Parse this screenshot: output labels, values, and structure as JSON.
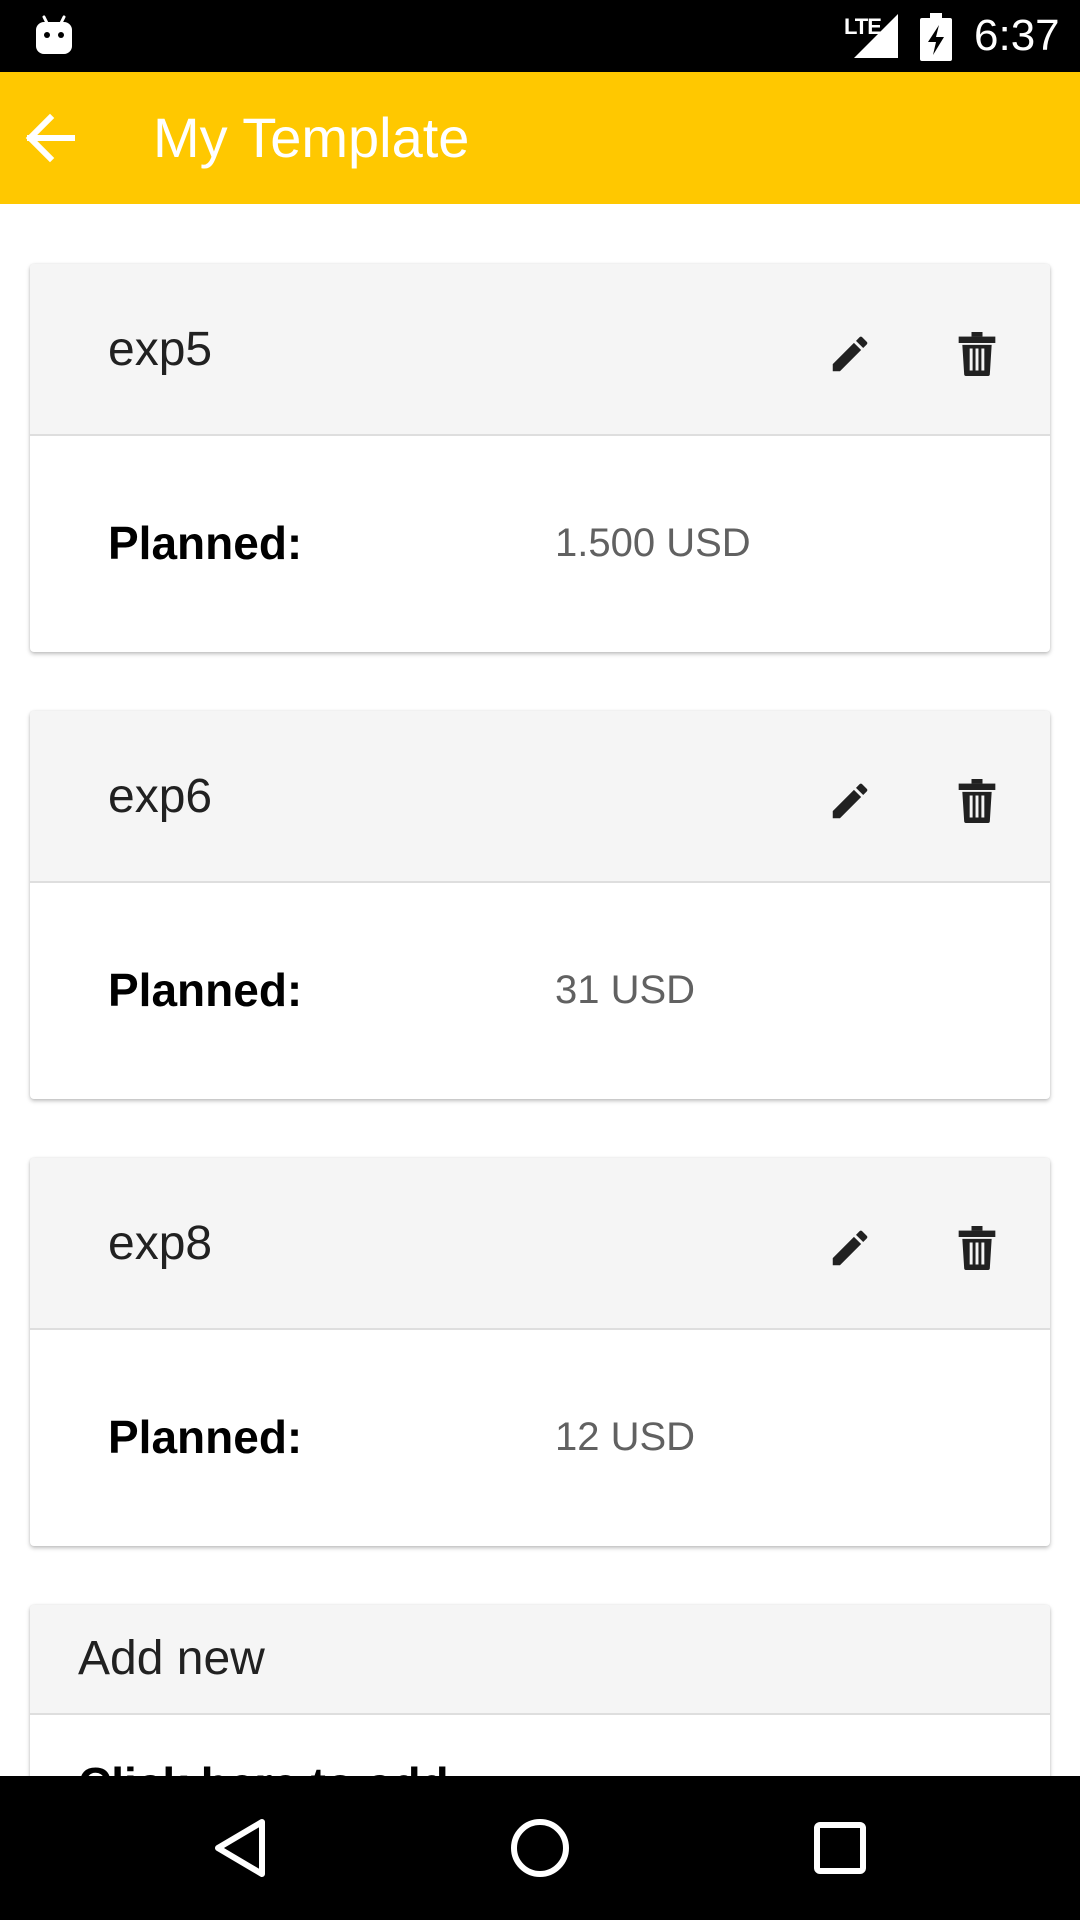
{
  "status_bar": {
    "network_label": "LTE",
    "time": "6:37",
    "icons": [
      "android-icon",
      "lte-signal-icon",
      "battery-charging-icon"
    ]
  },
  "app_bar": {
    "title": "My Template",
    "back_icon": "arrow-back-icon",
    "color": "#FFC800"
  },
  "expenses": [
    {
      "name": "exp5",
      "planned_label": "Planned:",
      "planned_value": "1.500 USD"
    },
    {
      "name": "exp6",
      "planned_label": "Planned:",
      "planned_value": "31 USD"
    },
    {
      "name": "exp8",
      "planned_label": "Planned:",
      "planned_value": "12 USD"
    }
  ],
  "add_new": {
    "title": "Add new",
    "body_text": "Click here to add"
  },
  "card_icons": [
    "edit-icon",
    "delete-icon"
  ],
  "nav_bar": {
    "icons": [
      "back-triangle-icon",
      "home-circle-icon",
      "recents-square-icon"
    ]
  }
}
